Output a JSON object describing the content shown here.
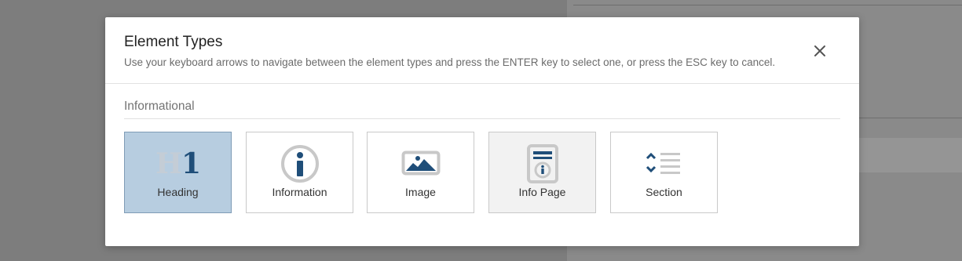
{
  "dialog": {
    "title": "Element Types",
    "subtitle": "Use your keyboard arrows to navigate between the element types and press the ENTER key to select one, or press the ESC key to cancel.",
    "close_icon": "close-icon"
  },
  "section": {
    "label": "Informational"
  },
  "tiles": [
    {
      "label": "Heading",
      "icon": "heading-h1-icon",
      "glyph_h": "H",
      "glyph_1": "1",
      "state": "selected"
    },
    {
      "label": "Information",
      "icon": "info-circle-icon",
      "state": "normal"
    },
    {
      "label": "Image",
      "icon": "image-icon",
      "state": "normal"
    },
    {
      "label": "Info Page",
      "icon": "info-page-icon",
      "state": "hovered"
    },
    {
      "label": "Section",
      "icon": "section-icon",
      "state": "normal"
    }
  ],
  "colors": {
    "accent": "#1f4e79",
    "icon_gray": "#c8c8c8",
    "selected_bg": "#b7cde0",
    "overlay": "#7d7d7d"
  }
}
